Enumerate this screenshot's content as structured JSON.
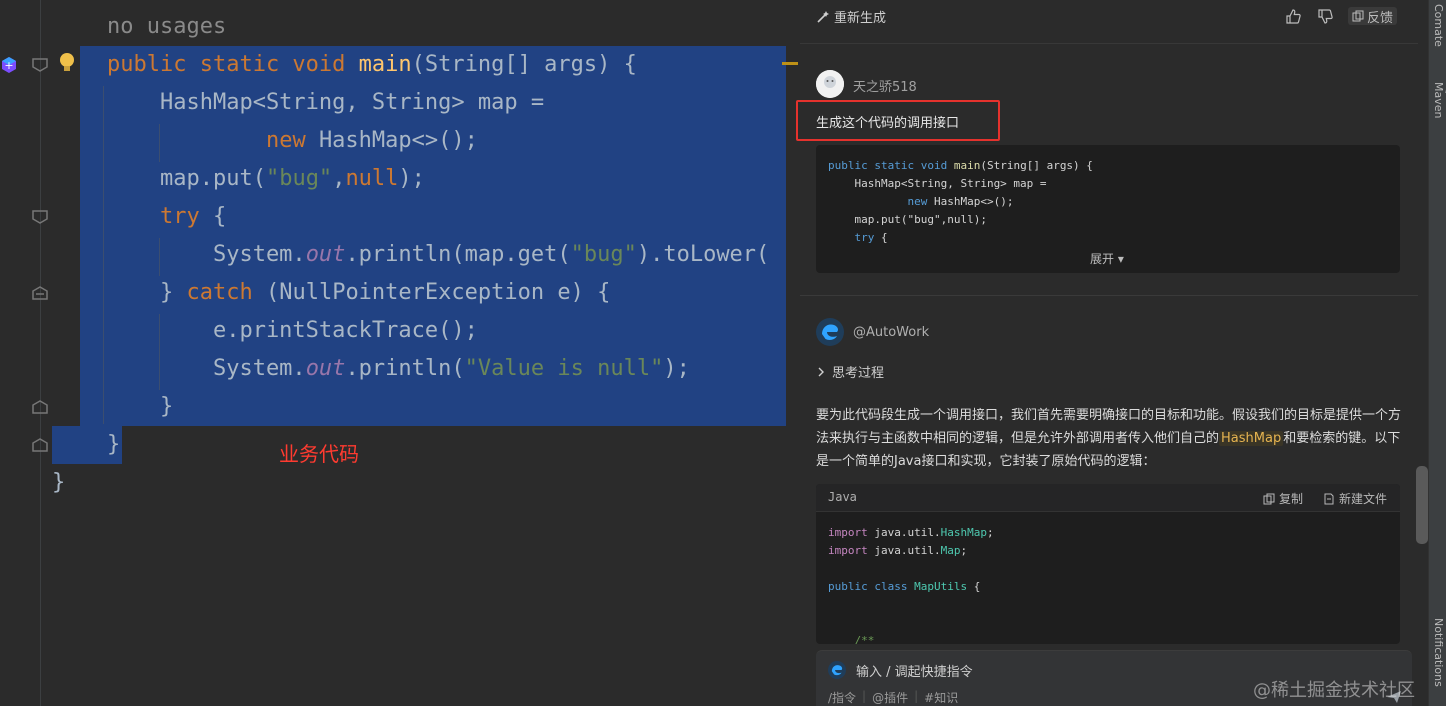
{
  "editor": {
    "usage_hint": "no usages",
    "annotation": "业务代码",
    "lines": [
      [
        {
          "t": "public static void ",
          "c": "kw"
        },
        {
          "t": "main",
          "c": "fn"
        },
        {
          "t": "(String[] args) {",
          "c": ""
        }
      ],
      [
        {
          "t": "    HashMap<String, String> map =",
          "c": ""
        }
      ],
      [
        {
          "t": "            ",
          "c": ""
        },
        {
          "t": "new ",
          "c": "kw"
        },
        {
          "t": "HashMap<>();",
          "c": ""
        }
      ],
      [
        {
          "t": "    map.put(",
          "c": ""
        },
        {
          "t": "\"bug\"",
          "c": "str"
        },
        {
          "t": ",",
          "c": ""
        },
        {
          "t": "null",
          "c": "kw"
        },
        {
          "t": ");",
          "c": ""
        }
      ],
      [
        {
          "t": "    ",
          "c": ""
        },
        {
          "t": "try ",
          "c": "kw"
        },
        {
          "t": "{",
          "c": ""
        }
      ],
      [
        {
          "t": "        System.",
          "c": ""
        },
        {
          "t": "out",
          "c": "fld"
        },
        {
          "t": ".println(map.get(",
          "c": ""
        },
        {
          "t": "\"bug\"",
          "c": "str"
        },
        {
          "t": ").toLower(",
          "c": ""
        }
      ],
      [
        {
          "t": "    } ",
          "c": ""
        },
        {
          "t": "catch ",
          "c": "kw"
        },
        {
          "t": "(NullPointerException e) {",
          "c": ""
        }
      ],
      [
        {
          "t": "        e.printStackTrace();",
          "c": ""
        }
      ],
      [
        {
          "t": "        System.",
          "c": ""
        },
        {
          "t": "out",
          "c": "fld"
        },
        {
          "t": ".println(",
          "c": ""
        },
        {
          "t": "\"Value is null\"",
          "c": "str"
        },
        {
          "t": ");",
          "c": ""
        }
      ],
      [
        {
          "t": "    }",
          "c": ""
        }
      ],
      [
        {
          "t": "}",
          "c": ""
        }
      ]
    ],
    "closing_brace": "}"
  },
  "panel": {
    "toolbar": {
      "regenerate_label": "重新生成",
      "like_label": "",
      "dislike_label": "",
      "feedback_label": "反馈"
    },
    "user_message": {
      "username": "天之骄518",
      "prompt": "生成这个代码的调用接口",
      "code_lines": [
        [
          {
            "t": "public static void ",
            "c": "cc-kw2"
          },
          {
            "t": "main",
            "c": "cc-fn"
          },
          {
            "t": "(String[] args) {",
            "c": ""
          }
        ],
        [
          {
            "t": "    HashMap<String, String> map =",
            "c": ""
          }
        ],
        [
          {
            "t": "            new ",
            "c": "cc-kw2"
          },
          {
            "t": "HashMap<>();",
            "c": ""
          }
        ],
        [
          {
            "t": "    map.put(\"bug\",null);",
            "c": ""
          }
        ],
        [
          {
            "t": "    try ",
            "c": "cc-kw2"
          },
          {
            "t": "{",
            "c": ""
          }
        ]
      ],
      "expand_label": "展开 ▾"
    },
    "ai_message": {
      "username": "@AutoWork",
      "thinking_label": "思考过程",
      "paragraph_before": "要为此代码段生成一个调用接口，我们首先需要明确接口的目标和功能。假设我们的目标是提供一个方法来执行与主函数中相同的逻辑，但是允许外部调用者传入他们自己的",
      "paragraph_highlight": "HashMap",
      "paragraph_after": "和要检索的键。以下是一个简单的Java接口和实现，它封装了原始代码的逻辑：",
      "code_language": "Java",
      "copy_label": "复制",
      "new_file_label": "新建文件",
      "code_lines": [
        [
          {
            "t": "import ",
            "c": "cc-kw"
          },
          {
            "t": "java.util.",
            "c": ""
          },
          {
            "t": "HashMap",
            "c": "cc-cls"
          },
          {
            "t": ";",
            "c": ""
          }
        ],
        [
          {
            "t": "import ",
            "c": "cc-kw"
          },
          {
            "t": "java.util.",
            "c": ""
          },
          {
            "t": "Map",
            "c": "cc-cls"
          },
          {
            "t": ";",
            "c": ""
          }
        ],
        [
          {
            "t": "",
            "c": ""
          }
        ],
        [
          {
            "t": "public class ",
            "c": "cc-kw2"
          },
          {
            "t": "MapUtils",
            "c": "cc-cls"
          },
          {
            "t": " {",
            "c": ""
          }
        ],
        [
          {
            "t": "",
            "c": ""
          }
        ],
        [
          {
            "t": "",
            "c": ""
          }
        ],
        [
          {
            "t": "    /**",
            "c": "cc-cmt"
          }
        ]
      ]
    },
    "input": {
      "placeholder": "输入 / 调起快捷指令",
      "tools": [
        "/指令",
        "@插件",
        "#知识"
      ]
    }
  },
  "sidebar": {
    "tabs": [
      "Comate",
      "Maven",
      "Notifications"
    ]
  },
  "watermark": "@稀土掘金技术社区"
}
